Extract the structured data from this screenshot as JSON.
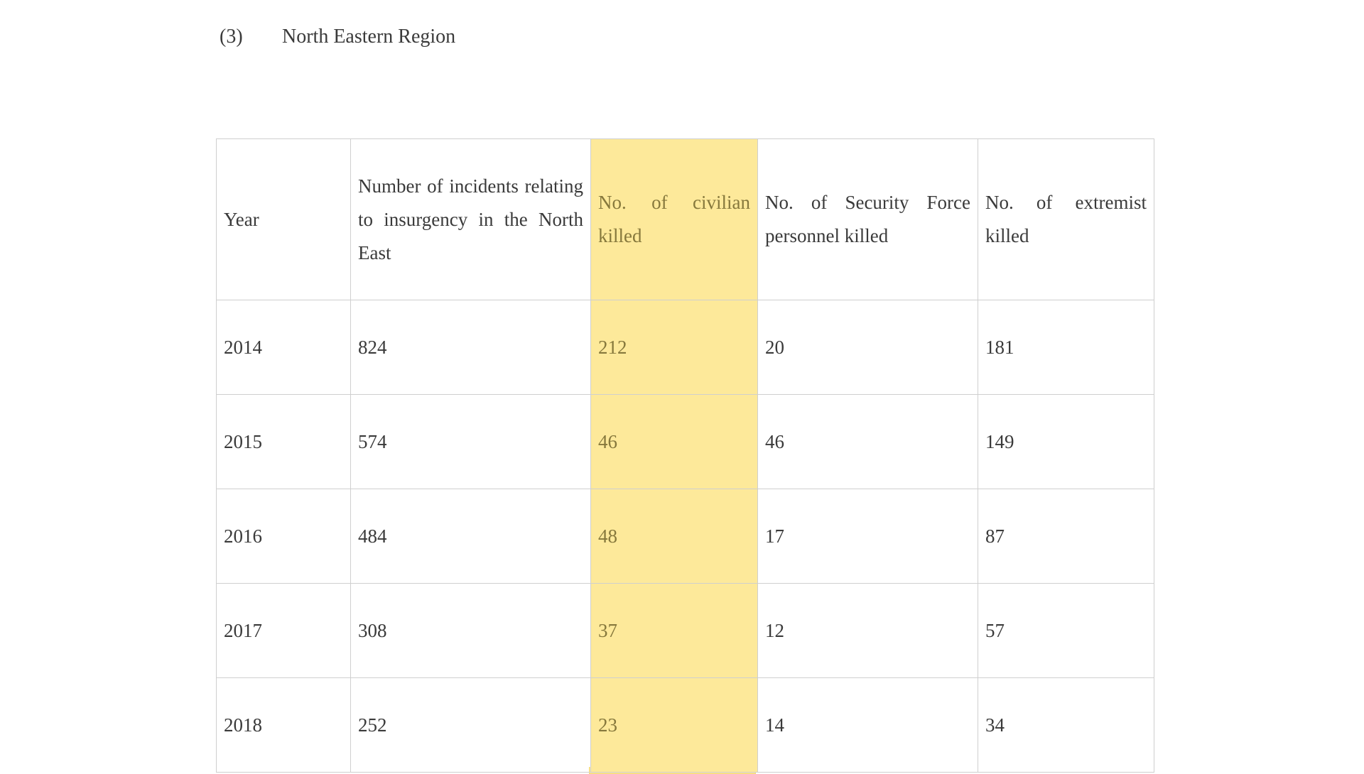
{
  "heading": {
    "number": "(3)",
    "title": "North Eastern Region"
  },
  "highlight_color": "#fde99a",
  "table": {
    "headers": [
      "Year",
      "Number of incidents relating to insurgency in the North East",
      "No. of civilian killed",
      "No. of Security Force personnel killed",
      "No. of extremist killed"
    ],
    "rows": [
      [
        "2014",
        "824",
        "212",
        "20",
        "181"
      ],
      [
        "2015",
        "574",
        "46",
        "46",
        "149"
      ],
      [
        "2016",
        "484",
        "48",
        "17",
        "87"
      ],
      [
        "2017",
        "308",
        "37",
        "12",
        "57"
      ],
      [
        "2018",
        "252",
        "23",
        "14",
        "34"
      ]
    ]
  }
}
